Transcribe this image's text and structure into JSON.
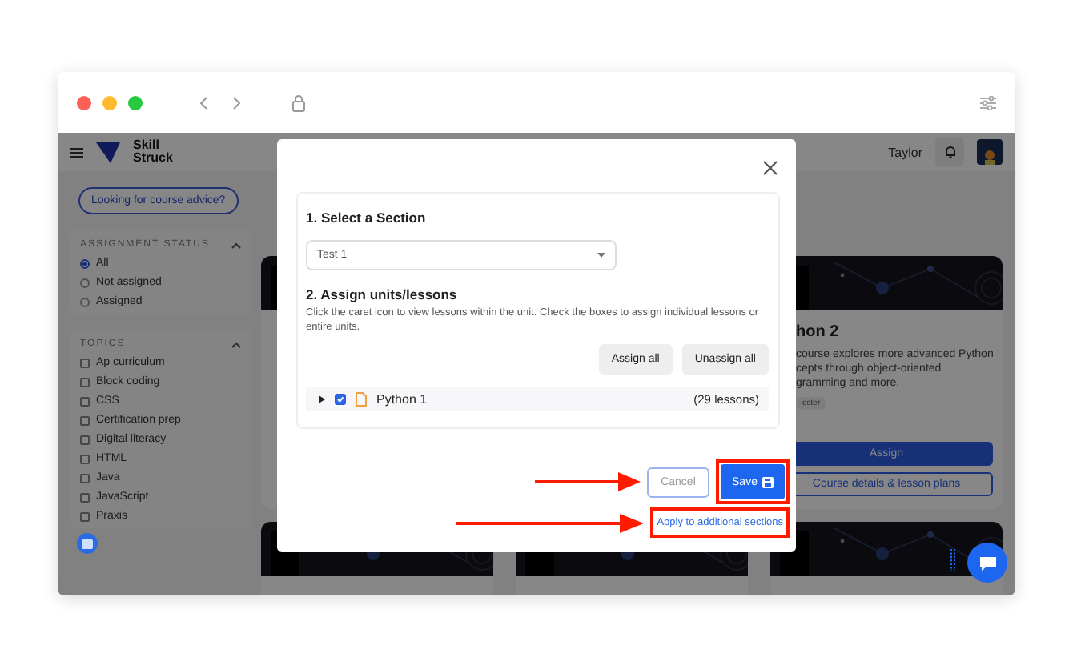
{
  "header": {
    "logo_lines": [
      "Skill",
      "Struck"
    ],
    "user_name": "Taylor"
  },
  "sidebar": {
    "advice_button": "Looking for course advice?",
    "assignment_status": {
      "title": "ASSIGNMENT STATUS",
      "expanded": true,
      "options": [
        {
          "label": "All",
          "selected": true
        },
        {
          "label": "Not assigned",
          "selected": false
        },
        {
          "label": "Assigned",
          "selected": false
        }
      ]
    },
    "topics": {
      "title": "TOPICS",
      "expanded": true,
      "items": [
        {
          "label": "Ap curriculum",
          "checked": false
        },
        {
          "label": "Block coding",
          "checked": false
        },
        {
          "label": "CSS",
          "checked": false
        },
        {
          "label": "Certification prep",
          "checked": false
        },
        {
          "label": "Digital literacy",
          "checked": false
        },
        {
          "label": "HTML",
          "checked": false
        },
        {
          "label": "Java",
          "checked": false
        },
        {
          "label": "JavaScript",
          "checked": false
        },
        {
          "label": "Praxis",
          "checked": false
        }
      ]
    }
  },
  "cards": [
    {
      "title": "hon 2",
      "description_lines": [
        "course explores more advanced Python",
        "cepts through object-oriented",
        "gramming and more."
      ],
      "tag": "ester",
      "primary_button": "Assign",
      "secondary_button": "Course details & lesson plans"
    }
  ],
  "modal": {
    "section_heading": "1. Select a Section",
    "section_select": {
      "value": "Test 1"
    },
    "units_heading": "2. Assign units/lessons",
    "units_help": "Click the caret icon to view lessons within the unit. Check the boxes to assign individual lessons or entire units.",
    "buttons": [
      "Assign all",
      "Unassign all"
    ],
    "units": [
      {
        "name": "Python 1",
        "count": "(29 lessons)",
        "checked": true,
        "expanded": false
      }
    ],
    "cancel_button": "Cancel",
    "save_button": "Save",
    "apply_link": "Apply to additional sections"
  }
}
